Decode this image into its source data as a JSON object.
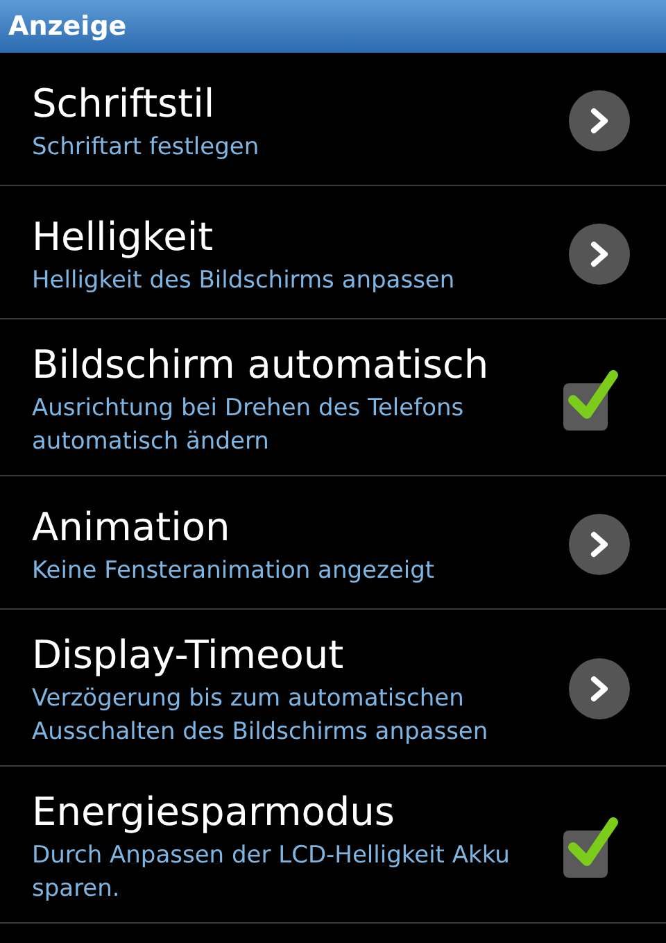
{
  "header": {
    "title": "Anzeige"
  },
  "items": [
    {
      "kind": "link",
      "title": "Schriftstil",
      "summary": "Schriftart festlegen"
    },
    {
      "kind": "link",
      "title": "Helligkeit",
      "summary": "Helligkeit des Bildschirms anpassen"
    },
    {
      "kind": "checkbox",
      "title": "Bildschirm automatisch",
      "summary": "Ausrichtung bei Drehen des Telefons automatisch ändern",
      "checked": true
    },
    {
      "kind": "link",
      "title": "Animation",
      "summary": "Keine Fensteranimation angezeigt"
    },
    {
      "kind": "link",
      "title": "Display-Timeout",
      "summary": "Verzögerung bis zum automatischen Ausschalten des Bildschirms anpassen"
    },
    {
      "kind": "checkbox",
      "title": "Energiesparmodus",
      "summary": "Durch Anpassen der LCD-Helligkeit Akku sparen.",
      "checked": true
    }
  ]
}
